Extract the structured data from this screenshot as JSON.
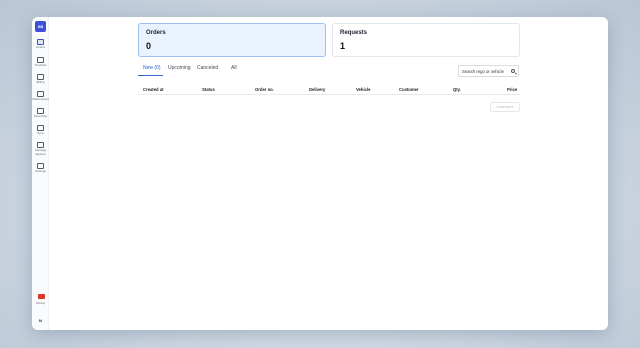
{
  "sidebar": {
    "logo": "SB",
    "items": [
      {
        "label": "Orders",
        "icon": "orders-icon",
        "active": true
      },
      {
        "label": "Products",
        "icon": "products-icon"
      },
      {
        "label": "Billing",
        "icon": "billing-icon"
      },
      {
        "label": "Warehouses",
        "icon": "warehouse-icon"
      },
      {
        "label": "Receiving",
        "icon": "receiving-icon"
      },
      {
        "label": "Sync",
        "icon": "sync-icon"
      },
      {
        "label": "Carriage logistics",
        "icon": "truck-icon"
      },
      {
        "label": "Settings",
        "icon": "settings-icon"
      }
    ],
    "activity_label": "Activity",
    "user_initial": "N"
  },
  "cards": {
    "orders": {
      "label": "Orders",
      "value": "0"
    },
    "requests": {
      "label": "Requests",
      "value": "1"
    }
  },
  "tabs": [
    {
      "label": "New (0)",
      "active": true
    },
    {
      "label": "Upcoming"
    },
    {
      "label": "Canceled"
    },
    {
      "label": "All"
    }
  ],
  "search": {
    "placeholder": "Search rego or vehicle"
  },
  "table": {
    "columns": [
      "Created at",
      "Status",
      "Order no.",
      "Delivery",
      "Vehicle",
      "Customer",
      "Qty.",
      "Price"
    ]
  },
  "load_more_label": "Load more",
  "colors": {
    "accent": "#3b4fd8",
    "active_tab": "#2f5ec6",
    "badge": "#e0362a"
  }
}
